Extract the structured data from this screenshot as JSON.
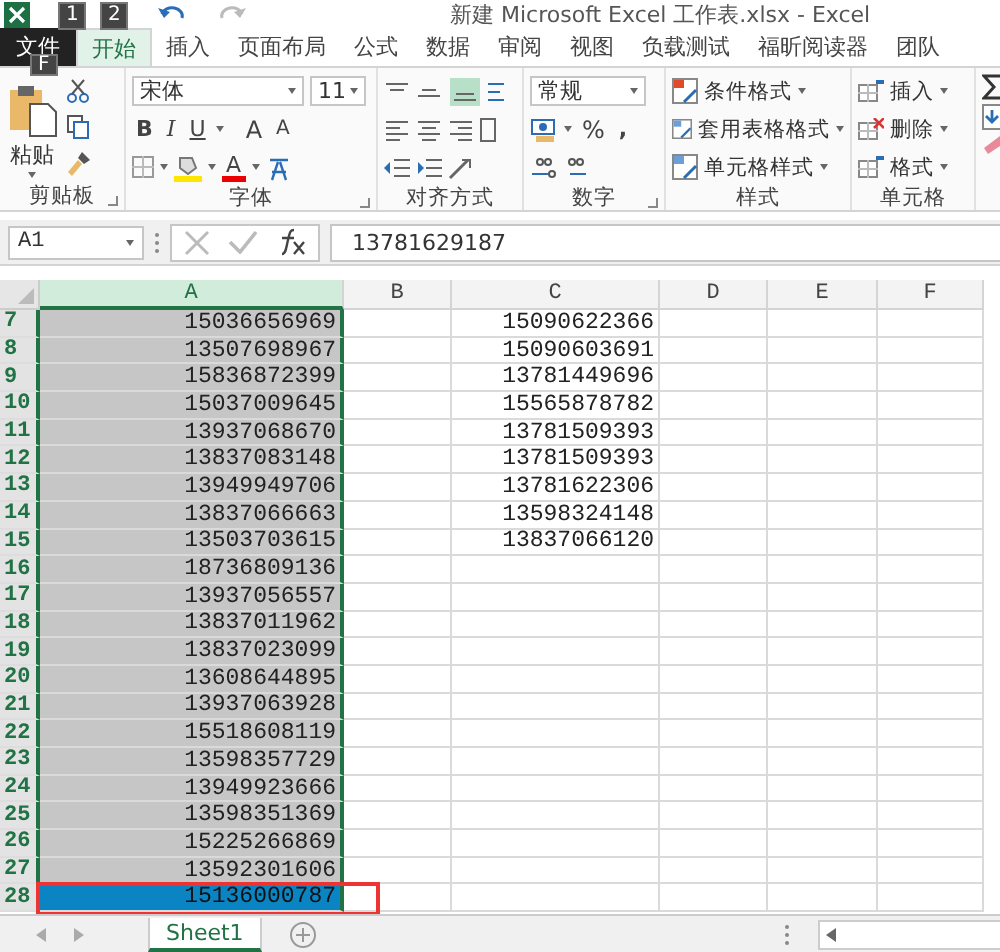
{
  "title": "新建 Microsoft Excel 工作表.xlsx - Excel",
  "key_tips": [
    "1",
    "2",
    "F"
  ],
  "tabs": [
    {
      "label": "文件",
      "kind": "file",
      "selected": false
    },
    {
      "label": "开始",
      "kind": "tab",
      "selected": true
    },
    {
      "label": "插入",
      "kind": "tab",
      "selected": false
    },
    {
      "label": "页面布局",
      "kind": "tab",
      "selected": false
    },
    {
      "label": "公式",
      "kind": "tab",
      "selected": false
    },
    {
      "label": "数据",
      "kind": "tab",
      "selected": false
    },
    {
      "label": "审阅",
      "kind": "tab",
      "selected": false
    },
    {
      "label": "视图",
      "kind": "tab",
      "selected": false
    },
    {
      "label": "负载测试",
      "kind": "tab",
      "selected": false
    },
    {
      "label": "福昕阅读器",
      "kind": "tab",
      "selected": false
    },
    {
      "label": "团队",
      "kind": "tab",
      "selected": false
    }
  ],
  "ribbon": {
    "clipboard": {
      "paste": "粘贴",
      "label": "剪贴板"
    },
    "font": {
      "name": "宋体",
      "size": "11",
      "bold": "B",
      "italic": "I",
      "underline": "U",
      "grow": "A",
      "shrink": "A",
      "color_button": "A",
      "label": "字体"
    },
    "alignment": {
      "label": "对齐方式"
    },
    "number": {
      "format": "常规",
      "percent": "%",
      "comma": ",",
      "label": "数字"
    },
    "styles": {
      "items": [
        "条件格式",
        "套用表格格式",
        "单元格样式"
      ],
      "label": "样式"
    },
    "cells": {
      "items": [
        "插入",
        "删除",
        "格式"
      ],
      "label": "单元格"
    }
  },
  "name_box": "A1",
  "formula": "13781629187",
  "columns": [
    {
      "label": "A",
      "selected": true
    },
    {
      "label": "B",
      "selected": false
    },
    {
      "label": "C",
      "selected": false
    },
    {
      "label": "D",
      "selected": false
    },
    {
      "label": "E",
      "selected": false
    },
    {
      "label": "F",
      "selected": false
    }
  ],
  "rows": [
    {
      "number": "7",
      "a": "15036656969",
      "c": "15090622366",
      "active": false,
      "marked": false
    },
    {
      "number": "8",
      "a": "13507698967",
      "c": "15090603691",
      "active": false,
      "marked": false
    },
    {
      "number": "9",
      "a": "15836872399",
      "c": "13781449696",
      "active": false,
      "marked": false
    },
    {
      "number": "10",
      "a": "15037009645",
      "c": "15565878782",
      "active": false,
      "marked": false
    },
    {
      "number": "11",
      "a": "13937068670",
      "c": "13781509393",
      "active": false,
      "marked": false
    },
    {
      "number": "12",
      "a": "13837083148",
      "c": "13781509393",
      "active": false,
      "marked": false
    },
    {
      "number": "13",
      "a": "13949949706",
      "c": "13781622306",
      "active": false,
      "marked": false
    },
    {
      "number": "14",
      "a": "13837066663",
      "c": "13598324148",
      "active": false,
      "marked": false
    },
    {
      "number": "15",
      "a": "13503703615",
      "c": "13837066120",
      "active": false,
      "marked": false
    },
    {
      "number": "16",
      "a": "18736809136",
      "active": false,
      "marked": false
    },
    {
      "number": "17",
      "a": "13937056557",
      "active": false,
      "marked": false
    },
    {
      "number": "18",
      "a": "13837011962",
      "active": false,
      "marked": false
    },
    {
      "number": "19",
      "a": "13837023099",
      "active": false,
      "marked": false
    },
    {
      "number": "20",
      "a": "13608644895",
      "active": false,
      "marked": false
    },
    {
      "number": "21",
      "a": "13937063928",
      "active": false,
      "marked": false
    },
    {
      "number": "22",
      "a": "15518608119",
      "active": false,
      "marked": false
    },
    {
      "number": "23",
      "a": "13598357729",
      "active": false,
      "marked": false
    },
    {
      "number": "24",
      "a": "13949923666",
      "active": false,
      "marked": false
    },
    {
      "number": "25",
      "a": "13598351369",
      "active": false,
      "marked": false
    },
    {
      "number": "26",
      "a": "15225266869",
      "active": false,
      "marked": false
    },
    {
      "number": "27",
      "a": "13592301606",
      "active": false,
      "marked": false
    },
    {
      "number": "28",
      "a": "15136000787",
      "active": true,
      "marked": true
    }
  ],
  "sheet_tabs": [
    {
      "label": "Sheet1",
      "selected": true
    }
  ]
}
